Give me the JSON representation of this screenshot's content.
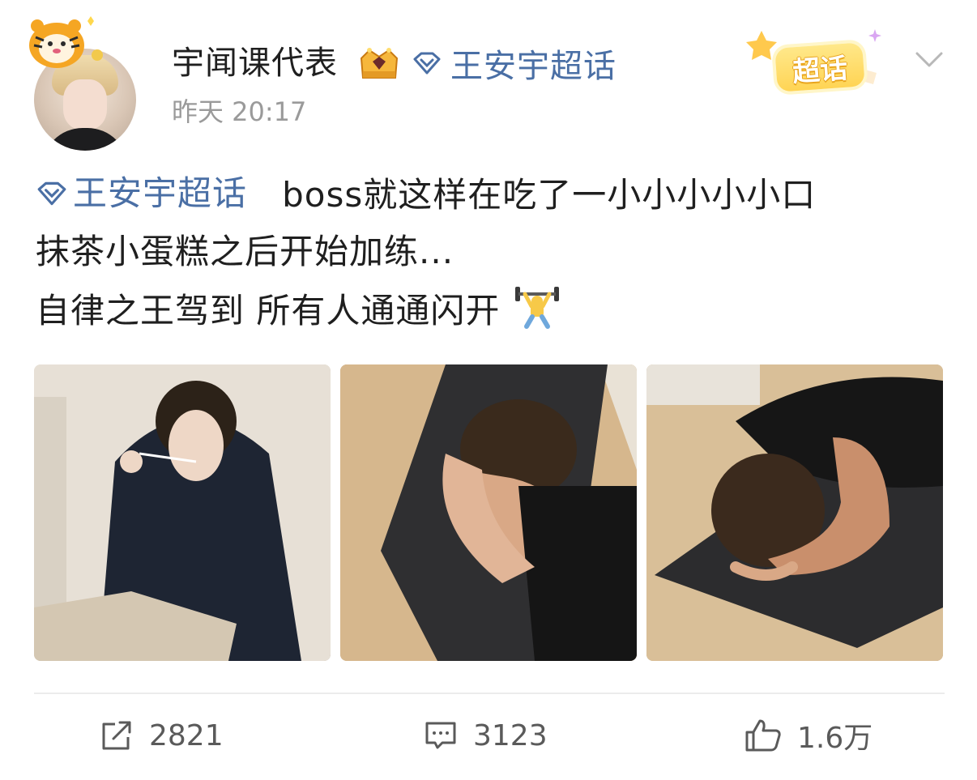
{
  "post": {
    "username": "宇闻课代表",
    "topic_label": "王安宇超话",
    "timestamp": "昨天 20:17",
    "badge_text": "超话",
    "content": {
      "tag": "王安宇超话",
      "line1_text": "boss就这样在吃了一小小小小小口",
      "line2_text": "抹茶小蛋糕之后开始加练...",
      "line3_text": "自律之王驾到 所有人通通闪开"
    },
    "images": [
      {
        "alt": "photo-1"
      },
      {
        "alt": "photo-2"
      },
      {
        "alt": "photo-3"
      }
    ],
    "actions": {
      "repost_count": "2821",
      "comment_count": "3123",
      "like_count": "1.6万"
    }
  },
  "colors": {
    "link_blue": "#4a6fa5",
    "text_primary": "#1f1f1f",
    "text_secondary": "#9a9a9a",
    "badge_yellow": "#ffd454"
  },
  "icons": {
    "topic": "diamond-topic-icon",
    "crown": "crown-badge-icon",
    "chevron": "chevron-down-icon",
    "repost": "repost-icon",
    "comment": "comment-icon",
    "like": "thumbs-up-icon",
    "emoji": "weightlifter-emoji-icon"
  }
}
